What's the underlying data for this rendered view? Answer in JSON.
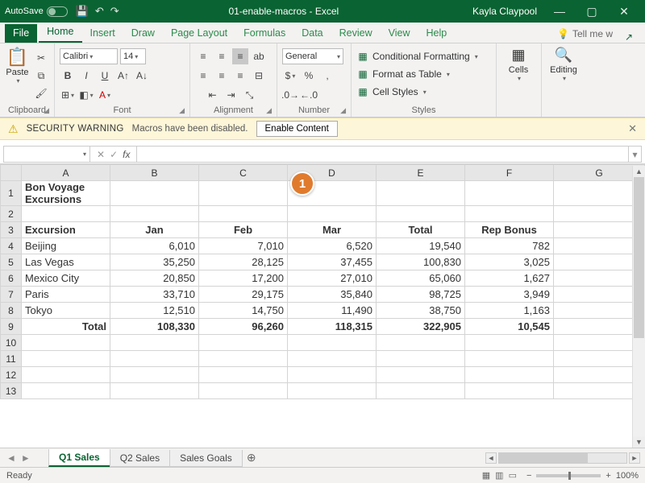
{
  "titlebar": {
    "autosave": "AutoSave",
    "doc": "01-enable-macros - Excel",
    "user": "Kayla Claypool"
  },
  "tabs": {
    "file": "File",
    "home": "Home",
    "insert": "Insert",
    "draw": "Draw",
    "pagelayout": "Page Layout",
    "formulas": "Formulas",
    "data": "Data",
    "review": "Review",
    "view": "View",
    "help": "Help",
    "tellme": "Tell me w"
  },
  "ribbon": {
    "clipboard": "Clipboard",
    "paste": "Paste",
    "font": "Font",
    "fontname": "Calibri",
    "fontsize": "14",
    "alignment": "Alignment",
    "number": "Number",
    "numfmt": "General",
    "styles": "Styles",
    "condfmt": "Conditional Formatting",
    "fmttable": "Format as Table",
    "cellstyles": "Cell Styles",
    "cells": "Cells",
    "editing": "Editing"
  },
  "security": {
    "title": "SECURITY WARNING",
    "msg": "Macros have been disabled.",
    "btn": "Enable Content"
  },
  "callout": {
    "n1": "1"
  },
  "fx": {
    "label": "fx"
  },
  "columns": [
    "A",
    "B",
    "C",
    "D",
    "E",
    "F",
    "G"
  ],
  "sheet": {
    "title": "Bon Voyage Excursions",
    "headers": {
      "excursion": "Excursion",
      "jan": "Jan",
      "feb": "Feb",
      "mar": "Mar",
      "total": "Total",
      "bonus": "Rep Bonus"
    },
    "rows": [
      {
        "name": "Beijing",
        "jan": "6,010",
        "feb": "7,010",
        "mar": "6,520",
        "total": "19,540",
        "bonus": "782"
      },
      {
        "name": "Las Vegas",
        "jan": "35,250",
        "feb": "28,125",
        "mar": "37,455",
        "total": "100,830",
        "bonus": "3,025"
      },
      {
        "name": "Mexico City",
        "jan": "20,850",
        "feb": "17,200",
        "mar": "27,010",
        "total": "65,060",
        "bonus": "1,627"
      },
      {
        "name": "Paris",
        "jan": "33,710",
        "feb": "29,175",
        "mar": "35,840",
        "total": "98,725",
        "bonus": "3,949"
      },
      {
        "name": "Tokyo",
        "jan": "12,510",
        "feb": "14,750",
        "mar": "11,490",
        "total": "38,750",
        "bonus": "1,163"
      }
    ],
    "totals": {
      "label": "Total",
      "jan": "108,330",
      "feb": "96,260",
      "mar": "118,315",
      "total": "322,905",
      "bonus": "10,545"
    }
  },
  "sheettabs": {
    "t1": "Q1 Sales",
    "t2": "Q2 Sales",
    "t3": "Sales Goals"
  },
  "status": {
    "ready": "Ready",
    "zoom": "100%"
  }
}
